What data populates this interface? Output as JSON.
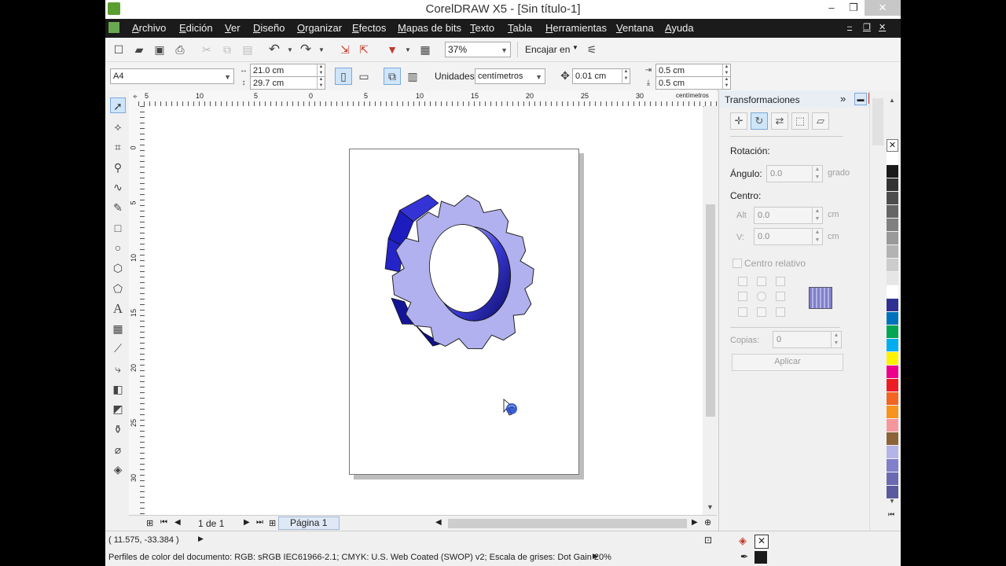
{
  "window": {
    "title": "CorelDRAW X5 - [Sin título-1]"
  },
  "menu": [
    "Archivo",
    "Edición",
    "Ver",
    "Diseño",
    "Organizar",
    "Efectos",
    "Mapas de bits",
    "Texto",
    "Tabla",
    "Herramientas",
    "Ventana",
    "Ayuda"
  ],
  "toolbar": {
    "zoom": "37%",
    "snap_label": "Encajar en"
  },
  "property_bar": {
    "paper_size": "A4",
    "width": "21.0 cm",
    "height": "29.7 cm",
    "units_label": "Unidades:",
    "units_value": "centímetros",
    "nudge": "0.01 cm",
    "dup_x": "0.5 cm",
    "dup_y": "0.5 cm"
  },
  "rulers": {
    "h_ticks": [
      "5",
      "10",
      "5",
      "0",
      "5",
      "10",
      "15",
      "20",
      "25",
      "30"
    ],
    "v_ticks": [
      "0",
      "5",
      "10",
      "15",
      "20",
      "25",
      "30"
    ],
    "unit": "centímetros"
  },
  "page_nav": {
    "counter": "1 de 1",
    "tab": "Página 1"
  },
  "docker": {
    "title": "Transformaciones",
    "section_rotation": "Rotación:",
    "angle_label": "Ángulo:",
    "angle_value": "0.0",
    "angle_unit": "grado",
    "center_label": "Centro:",
    "h_label": "Alt",
    "h_value": "0.0",
    "v_label": "V:",
    "v_value": "0.0",
    "unit": "cm",
    "relative_center": "Centro relativo",
    "copies_label": "Copias:",
    "copies_value": "0",
    "apply": "Aplicar"
  },
  "palette_colors": [
    "#ffffff",
    "#1a1a1a",
    "#333333",
    "#4d4d4d",
    "#666666",
    "#808080",
    "#999999",
    "#b3b3b3",
    "#cccccc",
    "#e6e6e6",
    "#ffffff",
    "#2e3192",
    "#0072bc",
    "#00a651",
    "#00aeef",
    "#fff200",
    "#ec008c",
    "#ed1c24",
    "#f26522",
    "#f7941d",
    "#f5989d",
    "#8c6239",
    "#b4b4e6",
    "#7f7fcc",
    "#6a6ab3",
    "#5a5a9e"
  ],
  "status": {
    "coords": "( 11.575, -33.384 )",
    "color_profiles": "Perfiles de color del documento: RGB: sRGB IEC61966-2.1; CMYK: U.S. Web Coated (SWOP) v2; Escala de grises: Dot Gain 20%"
  }
}
